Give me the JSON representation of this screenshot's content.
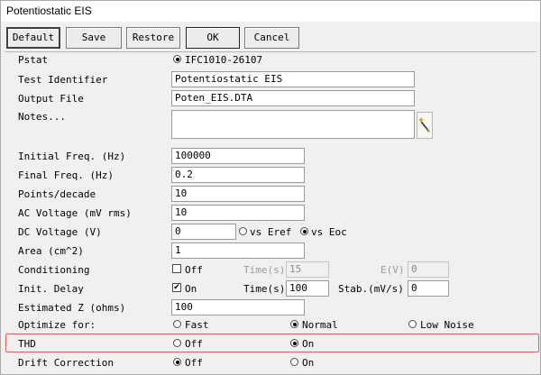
{
  "window": {
    "title": "Potentiostatic EIS"
  },
  "toolbar": {
    "default_label": "Default",
    "save_label": "Save",
    "restore_label": "Restore",
    "ok_label": "OK",
    "cancel_label": "Cancel"
  },
  "form": {
    "pstat": {
      "label": "Pstat",
      "value": "IFC1010-26107"
    },
    "test_identifier": {
      "label": "Test Identifier",
      "value": "Potentiostatic EIS"
    },
    "output_file": {
      "label": "Output File",
      "value": "Poten_EIS.DTA"
    },
    "notes": {
      "label": "Notes...",
      "value": ""
    },
    "initial_freq": {
      "label": "Initial Freq. (Hz)",
      "value": "100000"
    },
    "final_freq": {
      "label": "Final Freq. (Hz)",
      "value": "0.2"
    },
    "points_decade": {
      "label": "Points/decade",
      "value": "10"
    },
    "ac_voltage": {
      "label": "AC Voltage (mV rms)",
      "value": "10"
    },
    "dc_voltage": {
      "label": "DC Voltage (V)",
      "value": "0",
      "opt_eref": "vs Eref",
      "opt_eoc": "vs Eoc",
      "selected": "vs Eoc"
    },
    "area": {
      "label": "Area (cm^2)",
      "value": "1"
    },
    "conditioning": {
      "label": "Conditioning",
      "check_label": "Off",
      "checked": false,
      "time_label": "Time(s)",
      "time_value": "15",
      "e_label": "E(V)",
      "e_value": "0"
    },
    "init_delay": {
      "label": "Init. Delay",
      "check_label": "On",
      "checked": true,
      "time_label": "Time(s)",
      "time_value": "100",
      "stab_label": "Stab.(mV/s)",
      "stab_value": "0"
    },
    "estimated_z": {
      "label": "Estimated Z (ohms)",
      "value": "100"
    },
    "optimize": {
      "label": "Optimize for:",
      "opt_fast": "Fast",
      "opt_normal": "Normal",
      "opt_low_noise": "Low Noise",
      "selected": "Normal"
    },
    "thd": {
      "label": "THD",
      "opt_off": "Off",
      "opt_on": "On",
      "selected": "On"
    },
    "drift": {
      "label": "Drift Correction",
      "opt_off": "Off",
      "opt_on": "On",
      "selected": "Off"
    }
  },
  "colors": {
    "highlight_border": "#e06060",
    "window_bg": "#f0f0f0"
  },
  "icons": {
    "notes_editor": "wand-icon"
  }
}
